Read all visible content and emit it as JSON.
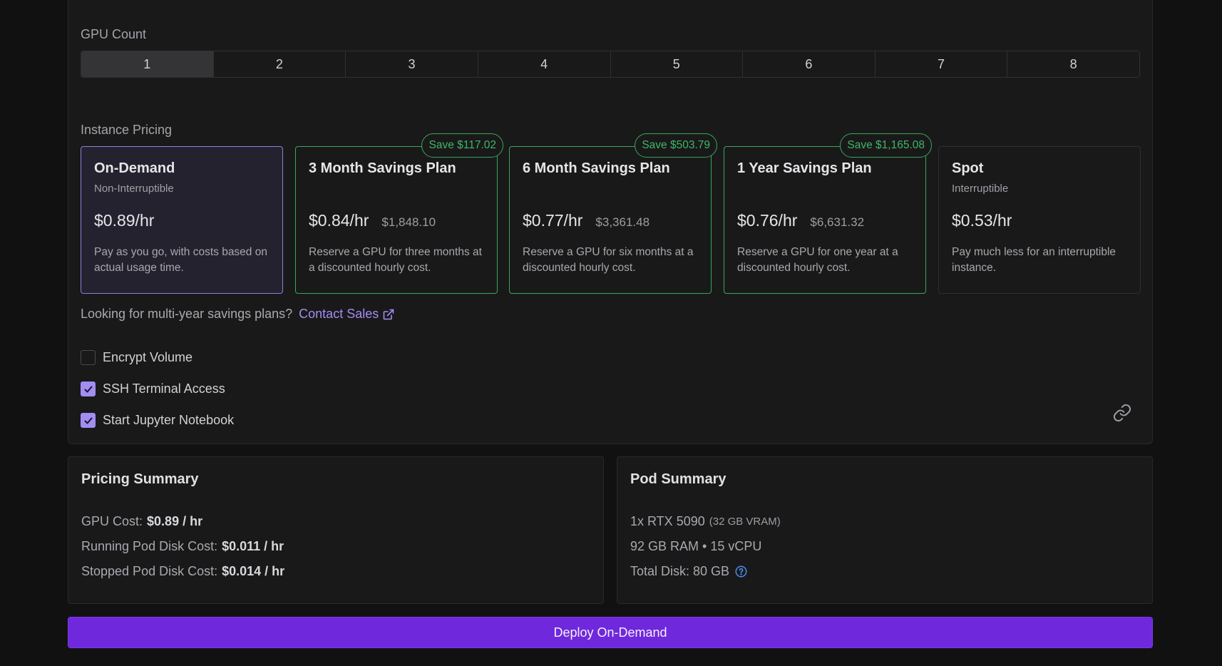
{
  "gpu_count": {
    "label": "GPU Count",
    "options": [
      "1",
      "2",
      "3",
      "4",
      "5",
      "6",
      "7",
      "8"
    ],
    "selected": "1"
  },
  "instance_pricing": {
    "label": "Instance Pricing",
    "plans": [
      {
        "title": "On-Demand",
        "subtitle": "Non-Interruptible",
        "price": "$0.89/hr",
        "total": "",
        "description": "Pay as you go, with costs based on actual usage time.",
        "badge": ""
      },
      {
        "title": "3 Month Savings Plan",
        "subtitle": "",
        "price": "$0.84/hr",
        "total": "$1,848.10",
        "description": "Reserve a GPU for three months at a discounted hourly cost.",
        "badge": "Save $117.02"
      },
      {
        "title": "6 Month Savings Plan",
        "subtitle": "",
        "price": "$0.77/hr",
        "total": "$3,361.48",
        "description": "Reserve a GPU for six months at a discounted hourly cost.",
        "badge": "Save $503.79"
      },
      {
        "title": "1 Year Savings Plan",
        "subtitle": "",
        "price": "$0.76/hr",
        "total": "$6,631.32",
        "description": "Reserve a GPU for one year at a discounted hourly cost.",
        "badge": "Save $1,165.08"
      },
      {
        "title": "Spot",
        "subtitle": "Interruptible",
        "price": "$0.53/hr",
        "total": "",
        "description": "Pay much less for an interruptible instance.",
        "badge": ""
      }
    ]
  },
  "contact": {
    "prompt": "Looking for multi-year savings plans?",
    "link_label": "Contact Sales"
  },
  "options": [
    {
      "label": "Encrypt Volume",
      "checked": false
    },
    {
      "label": "SSH Terminal Access",
      "checked": true
    },
    {
      "label": "Start Jupyter Notebook",
      "checked": true
    }
  ],
  "pricing_summary": {
    "title": "Pricing Summary",
    "gpu_cost_label": "GPU Cost:",
    "gpu_cost_value": "$0.89 / hr",
    "running_disk_label": "Running Pod Disk Cost:",
    "running_disk_value": "$0.011 / hr",
    "stopped_disk_label": "Stopped Pod Disk Cost:",
    "stopped_disk_value": "$0.014 / hr"
  },
  "pod_summary": {
    "title": "Pod Summary",
    "gpu": "1x RTX 5090",
    "vram": "(32 GB VRAM)",
    "specs": "92 GB RAM • 15 vCPU",
    "disk": "Total Disk: 80 GB"
  },
  "deploy_label": "Deploy On-Demand",
  "colors": {
    "accent_purple": "#6f28dc",
    "savings_green": "#39a65a",
    "selected_border": "#8f7dda",
    "checkbox_checked": "#a28df0",
    "link_purple": "#a58cf2"
  }
}
